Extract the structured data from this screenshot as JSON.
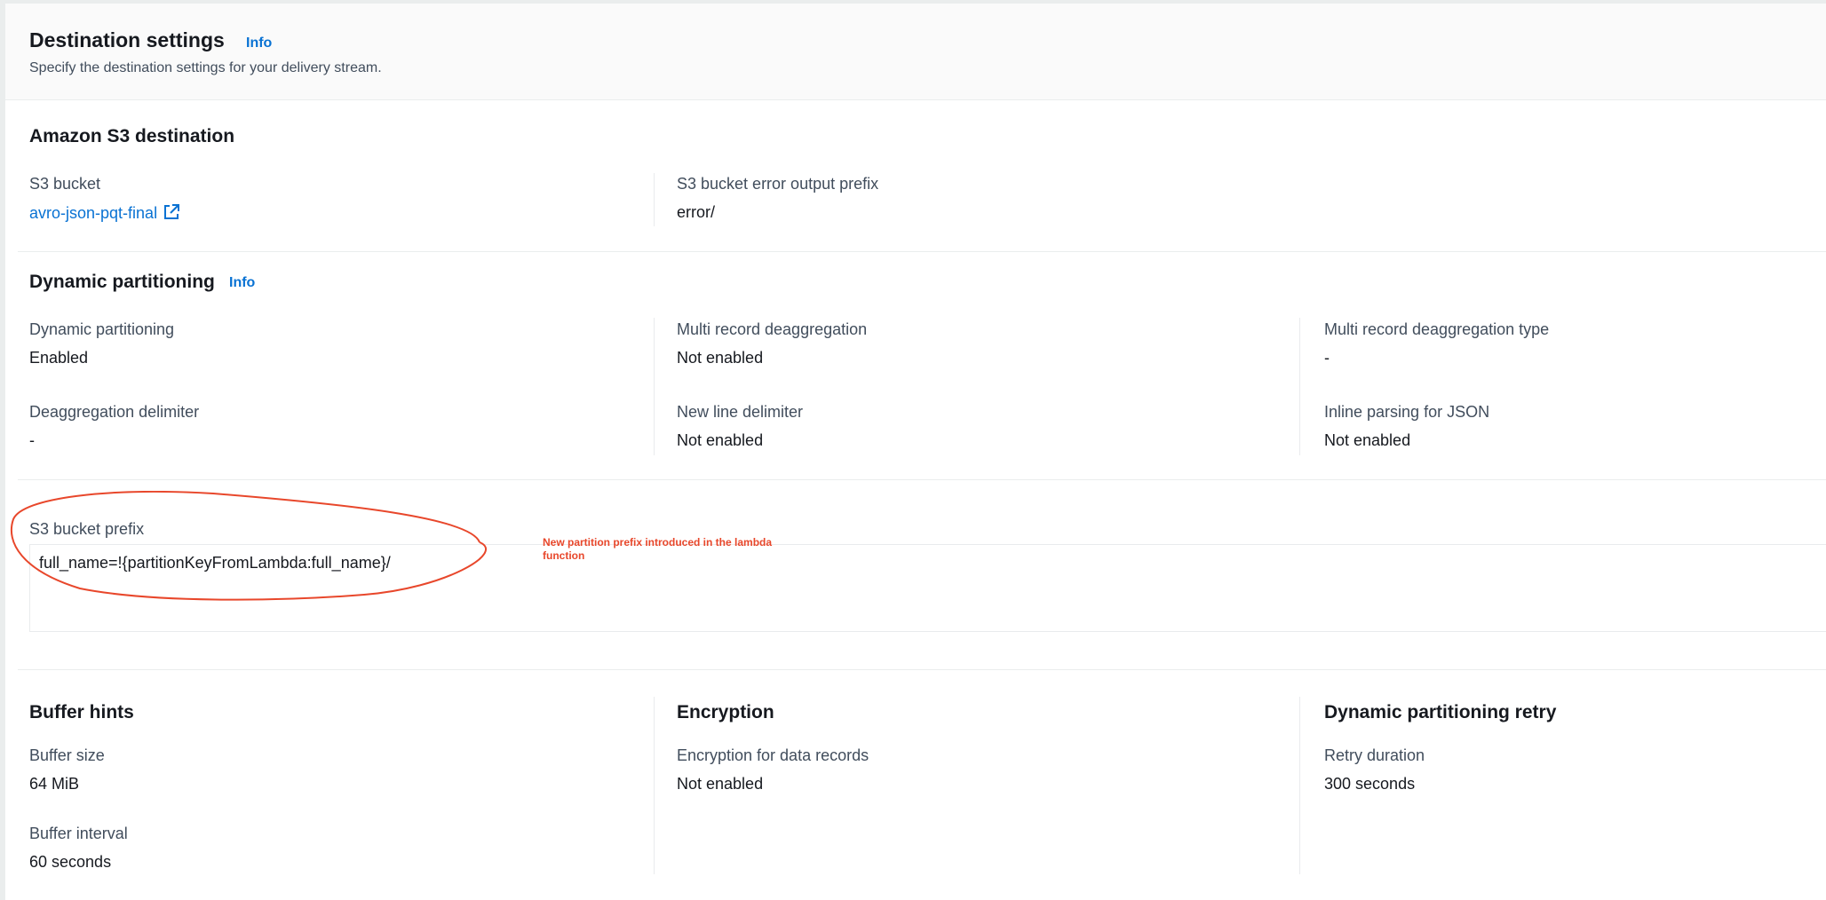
{
  "header": {
    "title": "Destination settings",
    "info_label": "Info",
    "description": "Specify the destination settings for your delivery stream."
  },
  "s3_destination": {
    "title": "Amazon S3 destination",
    "bucket_label": "S3 bucket",
    "bucket_value": "avro-json-pqt-final",
    "bucket_icon": "external-link-icon",
    "error_prefix_label": "S3 bucket error output prefix",
    "error_prefix_value": "error/"
  },
  "dynamic_partitioning": {
    "title": "Dynamic partitioning",
    "info_label": "Info",
    "fields": [
      {
        "label": "Dynamic partitioning",
        "value": "Enabled"
      },
      {
        "label": "Multi record deaggregation",
        "value": "Not enabled"
      },
      {
        "label": "Multi record deaggregation type",
        "value": "-"
      },
      {
        "label": "Deaggregation delimiter",
        "value": "-"
      },
      {
        "label": "New line delimiter",
        "value": "Not enabled"
      },
      {
        "label": "Inline parsing for JSON",
        "value": "Not enabled"
      }
    ]
  },
  "s3_prefix": {
    "label": "S3 bucket prefix",
    "value": "full_name=!{partitionKeyFromLambda:full_name}/",
    "annotation": "New partition prefix introduced in the lambda function",
    "annotation_color": "#e8472b"
  },
  "buffer_hints": {
    "title": "Buffer hints",
    "size_label": "Buffer size",
    "size_value": "64 MiB",
    "interval_label": "Buffer interval",
    "interval_value": "60 seconds"
  },
  "encryption": {
    "title": "Encryption",
    "label": "Encryption for data records",
    "value": "Not enabled"
  },
  "retry": {
    "title": "Dynamic partitioning retry",
    "label": "Retry duration",
    "value": "300 seconds"
  },
  "colors": {
    "link": "#0972d3",
    "text": "#16191f",
    "label": "#414d5c",
    "annotation": "#e8472b"
  }
}
